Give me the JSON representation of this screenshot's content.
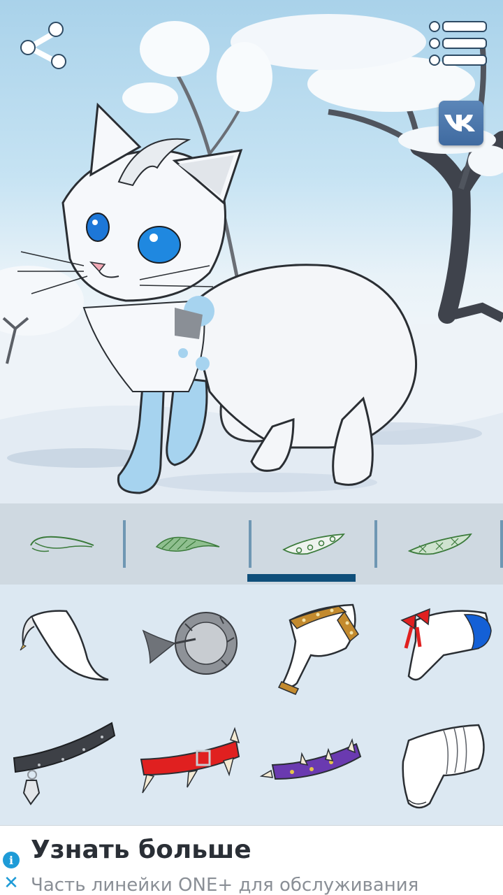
{
  "toolbar": {
    "share_icon": "share-icon",
    "menu_icon": "list-menu-icon",
    "vk_icon": "vk-logo",
    "vk_label": "vk"
  },
  "preview": {
    "subject": "white cat avatar in snowy landscape"
  },
  "categories": [
    {
      "icon": "eyebrow-plain-icon"
    },
    {
      "icon": "eyebrow-fluffy-icon"
    },
    {
      "icon": "eyebrow-pierced-icon",
      "selected": true
    },
    {
      "icon": "eyebrow-crossed-icon"
    }
  ],
  "items": [
    {
      "icon": "white-sleeve-icon"
    },
    {
      "icon": "gray-mane-icon"
    },
    {
      "icon": "studded-gold-sleeve-icon"
    },
    {
      "icon": "red-bow-sleeve-icon"
    },
    {
      "icon": "black-collar-icon"
    },
    {
      "icon": "red-spiked-collar-icon"
    },
    {
      "icon": "purple-spiked-collar-icon"
    },
    {
      "icon": "white-scrunch-sleeve-icon"
    }
  ],
  "ad": {
    "title": "Узнать больше",
    "subtitle": "Часть линейки ONE+ для обслуживания",
    "info_glyph": "i",
    "close_glyph": "✕"
  },
  "colors": {
    "accent": "#0f4f7a",
    "tab_separator": "#6f97b3",
    "tab_bg": "#cfd9e1",
    "grid_bg": "#dce8f2",
    "vk_blue": "#4a76a8",
    "ad_info": "#1e9bd7"
  }
}
